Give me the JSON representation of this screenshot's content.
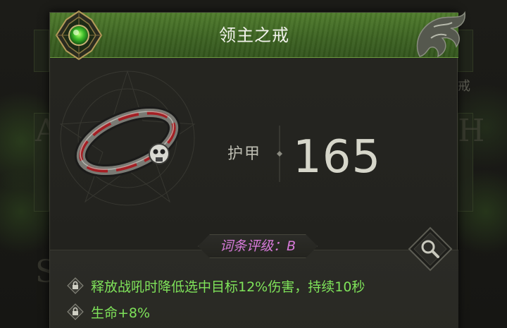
{
  "item": {
    "name": "领主之戒",
    "icon": "ring-icon"
  },
  "stat": {
    "label": "护甲",
    "value": "165"
  },
  "grade": {
    "text": "词条评级：B"
  },
  "affixes": [
    {
      "text": "释放战吼时降低选中目标12%伤害，持续10秒",
      "locked": true
    },
    {
      "text": "生命+8%",
      "locked": true
    }
  ],
  "background": {
    "partial_text": "戒"
  },
  "colors": {
    "header": "#4f7c2c",
    "affix_text": "#7fe35a",
    "grade_text": "#d77ad9",
    "panel": "#262621"
  },
  "icons": {
    "emblem": "green-gem-emblem-icon",
    "ornament": "dragon-ornament-icon",
    "zoom": "magnifier-icon",
    "lock": "lock-icon"
  }
}
